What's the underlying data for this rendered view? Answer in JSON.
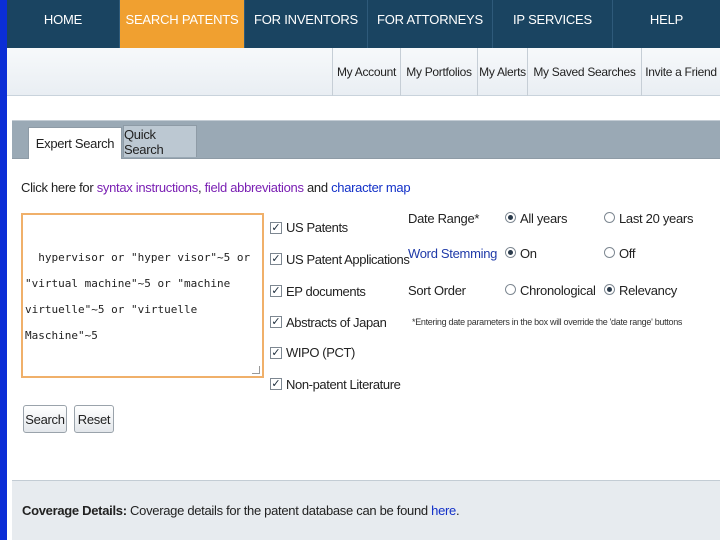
{
  "nav": {
    "items": [
      {
        "label": "HOME",
        "active": false
      },
      {
        "label": "SEARCH PATENTS",
        "active": true
      },
      {
        "label": "FOR INVENTORS",
        "active": false
      },
      {
        "label": "FOR ATTORNEYS",
        "active": false
      },
      {
        "label": "IP SERVICES",
        "active": false
      },
      {
        "label": "HELP",
        "active": false
      }
    ]
  },
  "subnav": {
    "items": [
      "My Account",
      "My Portfolios",
      "My Alerts",
      "My Saved Searches",
      "Invite a Friend"
    ]
  },
  "tabs": {
    "expert": "Expert Search",
    "quick": "Quick Search"
  },
  "help": {
    "prefix": "Click here for ",
    "syntax": "syntax instructions",
    "sep1": ", ",
    "fields": "field abbreviations",
    "sep2": " and ",
    "charmap": "character map"
  },
  "query": {
    "value": "hypervisor or \"hyper visor\"~5 or\n\"virtual machine\"~5 or \"machine\nvirtuelle\"~5 or \"virtuelle\nMaschine\"~5"
  },
  "sources": [
    {
      "label": "US Patents",
      "checked": true
    },
    {
      "label": "US Patent Applications",
      "checked": true
    },
    {
      "label": "EP documents",
      "checked": true
    },
    {
      "label": "Abstracts of Japan",
      "checked": true
    },
    {
      "label": "WIPO (PCT)",
      "checked": true
    },
    {
      "label": "Non-patent Literature",
      "checked": true
    }
  ],
  "options": {
    "date_range": {
      "label": "Date Range*",
      "opt1": "All years",
      "opt2": "Last 20 years",
      "selected": "All years"
    },
    "word_stemming": {
      "label": "Word Stemming",
      "opt1": "On",
      "opt2": "Off",
      "selected": "On"
    },
    "sort_order": {
      "label": "Sort Order",
      "opt1": "Chronological",
      "opt2": "Relevancy",
      "selected": "Relevancy"
    },
    "note": "*Entering date parameters in the box will override the 'date range' buttons"
  },
  "buttons": {
    "search": "Search",
    "reset": "Reset"
  },
  "coverage": {
    "title": "Coverage Details:",
    "text": " Coverage details for the patent database can be found ",
    "link": "here",
    "end": "."
  },
  "colors": {
    "nav_bg": "#1a4461",
    "nav_active": "#f0a030",
    "left_bar": "#0b2ed6",
    "tab_strip": "#9aa9b5"
  }
}
